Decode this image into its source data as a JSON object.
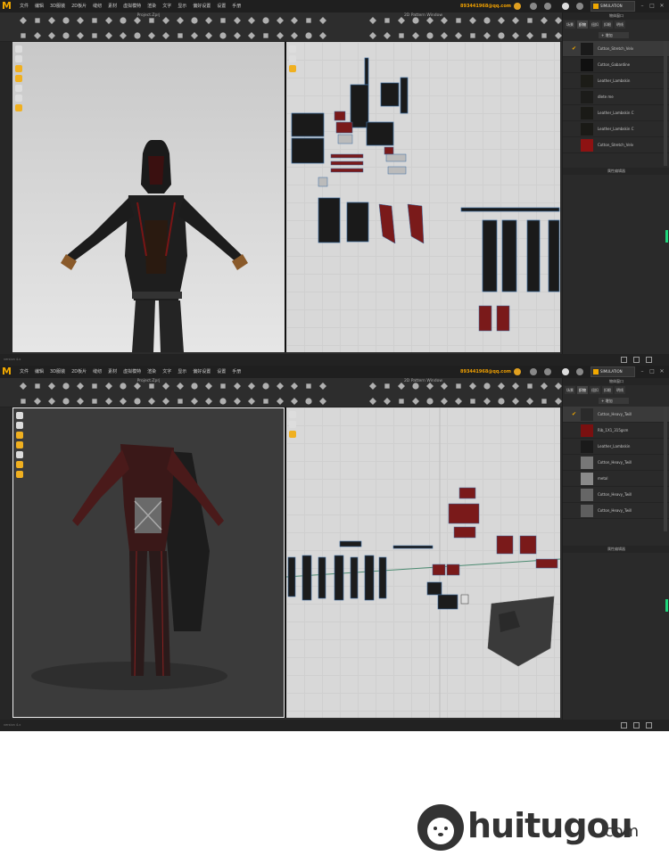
{
  "menu": [
    "文件",
    "编辑",
    "3D服装",
    "2D板片",
    "缝纫",
    "素材",
    "虚拟模特",
    "渲染",
    "文字",
    "显示",
    "偏好设置",
    "设置",
    "手册"
  ],
  "account": "893441968@qq.com",
  "simulation_label": "SIMULATION",
  "project_title": "Project.Zprj",
  "pattern_window_title": "2D Pattern Window",
  "object_browser_title": "物体窗口",
  "tabs": [
    "场景",
    "织物",
    "纽扣",
    "扣眼",
    "明线"
  ],
  "add_label": "+ 增加",
  "property_editor_title": "属性编辑器",
  "status_version": "version 4.x",
  "screens": [
    {
      "fabrics": [
        {
          "name": "Cotton_Stretch_Velv",
          "color": "#1a1a1a",
          "selected": true
        },
        {
          "name": "Cotton_Gabardine",
          "color": "#101010"
        },
        {
          "name": "Leather_Lambskin",
          "color": "#1c1c17"
        },
        {
          "name": "dlete me",
          "color": "#1c1c1a"
        },
        {
          "name": "Leather_Lambskin C",
          "color": "#1a1a16"
        },
        {
          "name": "Leather_Lambskin C",
          "color": "#1a1a16"
        },
        {
          "name": "Cotton_Stretch_Velv",
          "color": "#8e1212"
        }
      ]
    },
    {
      "fabrics": [
        {
          "name": "Cotton_Heavy_Twill",
          "color": "#2a2a2a",
          "selected": true
        },
        {
          "name": "Rib_1X1_315gsm",
          "color": "#7a1010"
        },
        {
          "name": "Leather_Lambskin",
          "color": "#1a1a1a"
        },
        {
          "name": "Cotton_Heavy_Twill",
          "color": "#777777"
        },
        {
          "name": "metal",
          "color": "#8a8a8a"
        },
        {
          "name": "Cotton_Heavy_Twill",
          "color": "#666666"
        },
        {
          "name": "Cotton_Heavy_Twill",
          "color": "#5e5e5e"
        }
      ]
    }
  ],
  "watermark": {
    "brand": "huitugou",
    "domain": ".com"
  },
  "colors": {
    "accent": "#f0a800",
    "menubar": "#1f1f1f",
    "panel": "#2a2a2a"
  }
}
